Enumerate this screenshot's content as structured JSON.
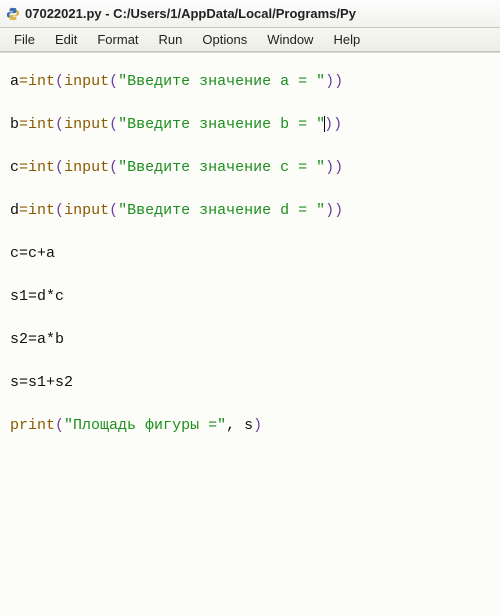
{
  "window": {
    "title": "07022021.py - C:/Users/1/AppData/Local/Programs/Py"
  },
  "menu": {
    "file": "File",
    "edit": "Edit",
    "format": "Format",
    "run": "Run",
    "options": "Options",
    "window": "Window",
    "help": "Help"
  },
  "code": {
    "l1a": "a",
    "eq": "=",
    "int": "int",
    "input": "input",
    "lp": "(",
    "rp": ")",
    "quote": "\"",
    "s_a": "Введите значение а = ",
    "l2a": "b",
    "s_b": "Введите значение b = ",
    "l3a": "c",
    "s_c": "Введите значение c = ",
    "l4a": "d",
    "s_d": "Введите значение d = ",
    "l5": "c=c+a",
    "l6": "s1=d*c",
    "l7": "s2=a*b",
    "l8": "s=s1+s2",
    "print": "print",
    "s_out": "Площадь фигуры =",
    "comma_s": ", s"
  }
}
